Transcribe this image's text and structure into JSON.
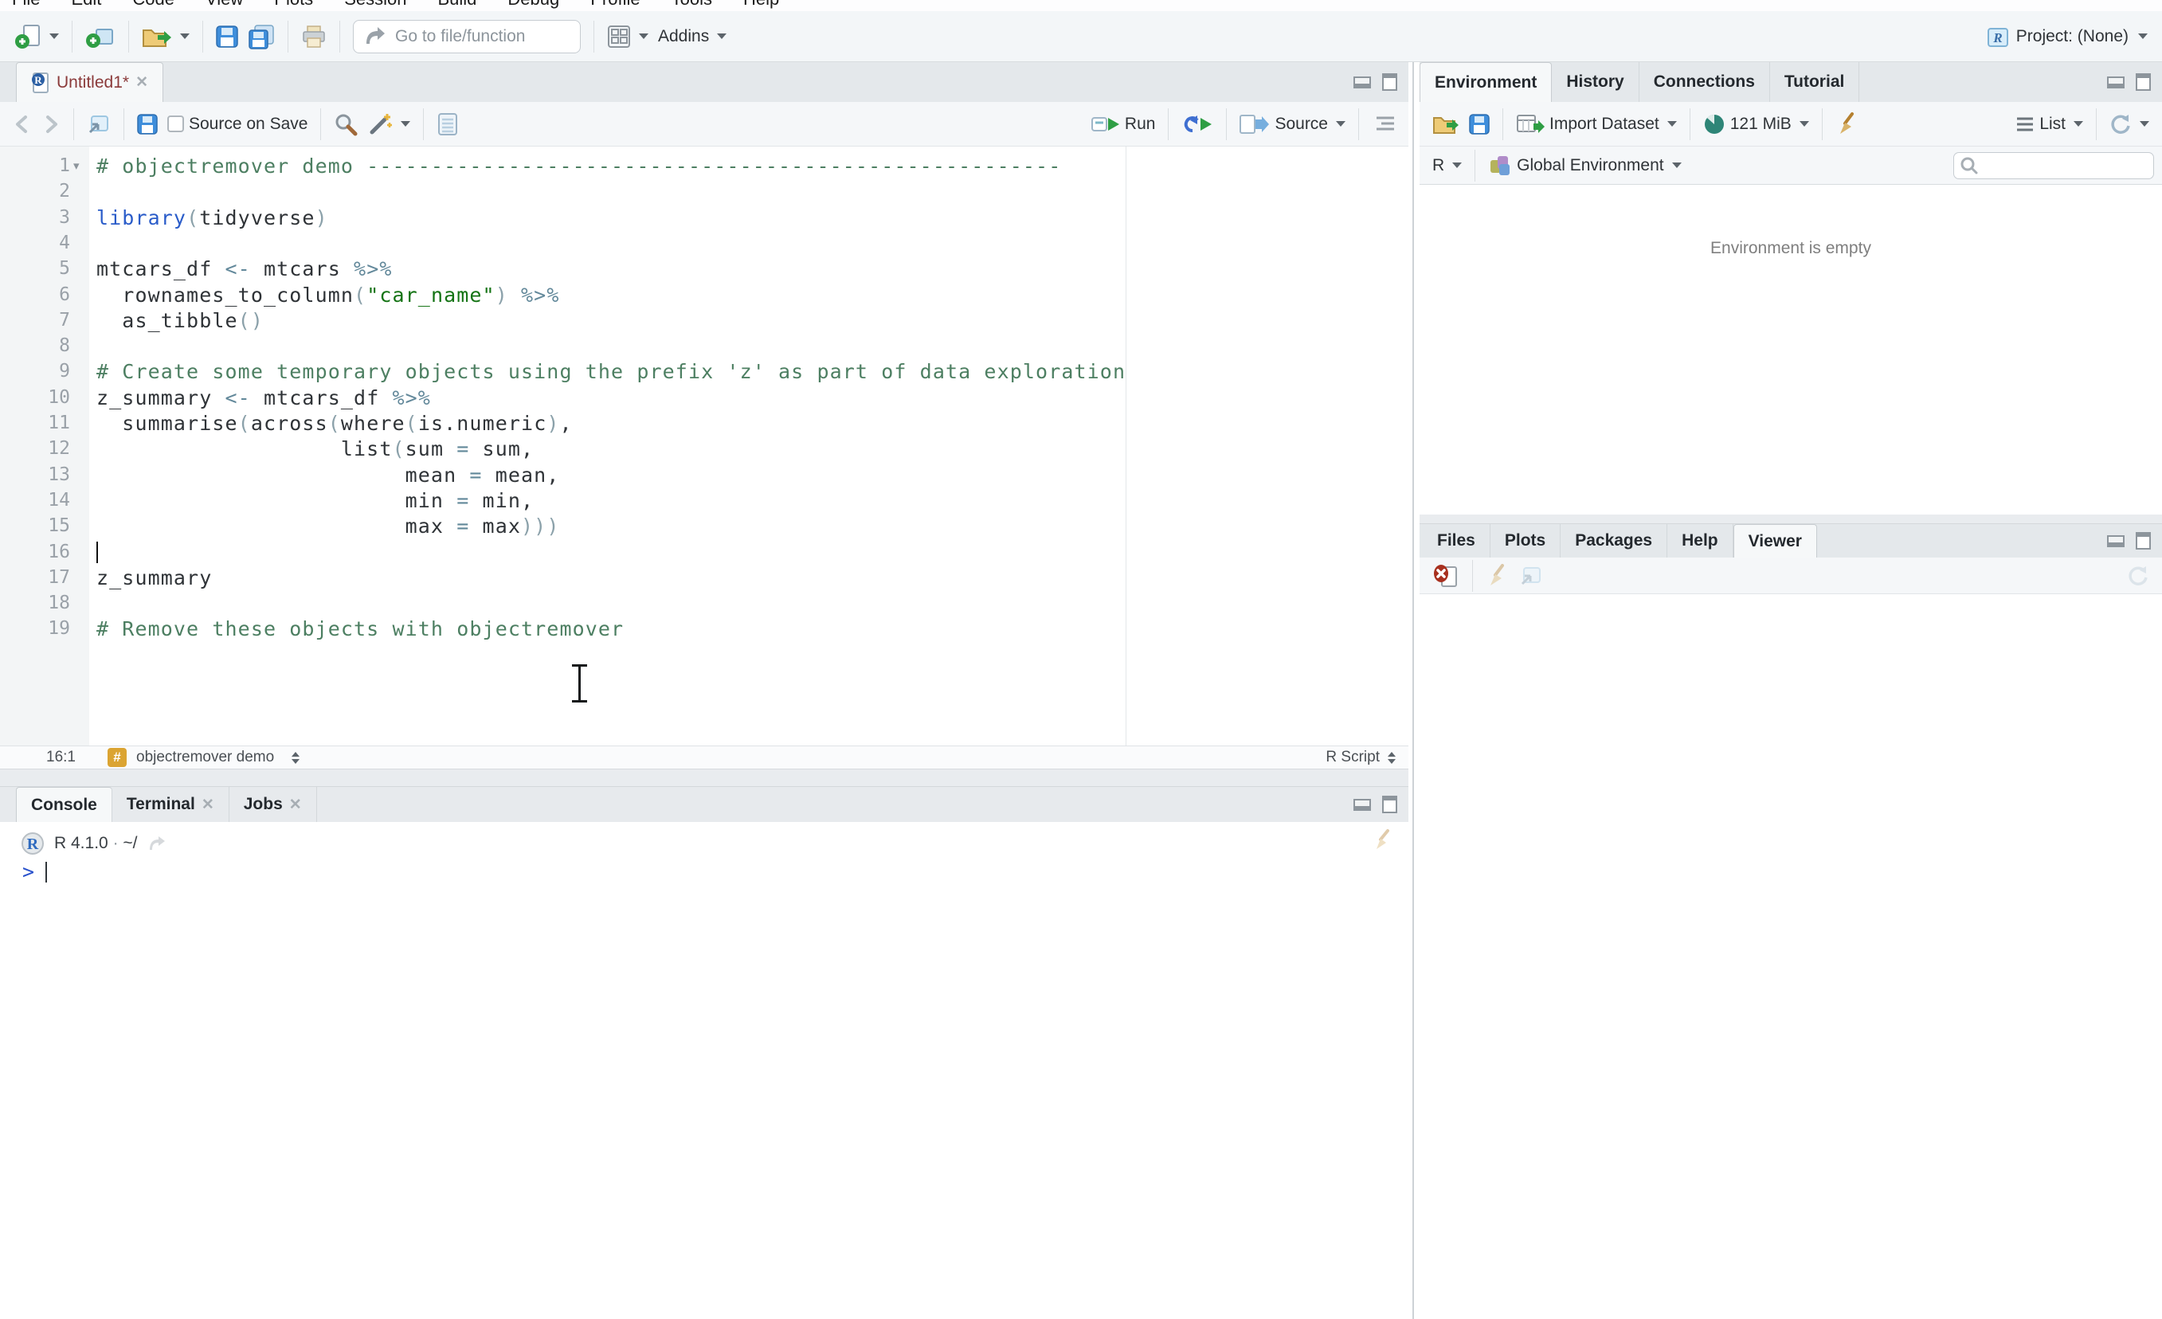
{
  "menu": [
    "File",
    "Edit",
    "Code",
    "View",
    "Plots",
    "Session",
    "Build",
    "Debug",
    "Profile",
    "Tools",
    "Help"
  ],
  "toolbar": {
    "goto_placeholder": "Go to file/function",
    "addins_label": "Addins",
    "project_label": "Project: (None)"
  },
  "source_pane": {
    "tab_title": "Untitled1*",
    "source_on_save_label": "Source on Save",
    "run_label": "Run",
    "source_label": "Source",
    "status": {
      "cursor_position": "16:1",
      "section_label": "objectremover demo",
      "file_type": "R Script"
    },
    "editor": {
      "cursor": {
        "line": 16,
        "column": 1
      },
      "lines": [
        {
          "n": 1,
          "fold": true,
          "tokens": [
            [
              "c",
              "# objectremover demo ------------------------------------------------------"
            ]
          ]
        },
        {
          "n": 2,
          "tokens": []
        },
        {
          "n": 3,
          "tokens": [
            [
              "k",
              "library"
            ],
            [
              "p",
              "("
            ],
            [
              "t",
              "tidyverse"
            ],
            [
              "p",
              ")"
            ]
          ]
        },
        {
          "n": 4,
          "tokens": []
        },
        {
          "n": 5,
          "tokens": [
            [
              "t",
              "mtcars_df "
            ],
            [
              "o",
              "<-"
            ],
            [
              "t",
              " mtcars "
            ],
            [
              "o",
              "%>%"
            ]
          ]
        },
        {
          "n": 6,
          "tokens": [
            [
              "t",
              "  rownames_to_column"
            ],
            [
              "p",
              "("
            ],
            [
              "s",
              "\"car_name\""
            ],
            [
              "p",
              ")"
            ],
            [
              "t",
              " "
            ],
            [
              "o",
              "%>%"
            ]
          ]
        },
        {
          "n": 7,
          "tokens": [
            [
              "t",
              "  as_tibble"
            ],
            [
              "p",
              "()"
            ]
          ]
        },
        {
          "n": 8,
          "tokens": []
        },
        {
          "n": 9,
          "tokens": [
            [
              "c",
              "# Create some temporary objects using the prefix 'z' as part of data exploration"
            ]
          ]
        },
        {
          "n": 10,
          "tokens": [
            [
              "t",
              "z_summary "
            ],
            [
              "o",
              "<-"
            ],
            [
              "t",
              " mtcars_df "
            ],
            [
              "o",
              "%>%"
            ]
          ]
        },
        {
          "n": 11,
          "tokens": [
            [
              "t",
              "  summarise"
            ],
            [
              "p",
              "("
            ],
            [
              "t",
              "across"
            ],
            [
              "p",
              "("
            ],
            [
              "t",
              "where"
            ],
            [
              "p",
              "("
            ],
            [
              "t",
              "is.numeric"
            ],
            [
              "p",
              ")"
            ],
            [
              "t",
              ","
            ]
          ]
        },
        {
          "n": 12,
          "tokens": [
            [
              "t",
              "                   list"
            ],
            [
              "p",
              "("
            ],
            [
              "t",
              "sum "
            ],
            [
              "o",
              "="
            ],
            [
              "t",
              " sum,"
            ]
          ]
        },
        {
          "n": 13,
          "tokens": [
            [
              "t",
              "                        mean "
            ],
            [
              "o",
              "="
            ],
            [
              "t",
              " mean,"
            ]
          ]
        },
        {
          "n": 14,
          "tokens": [
            [
              "t",
              "                        min "
            ],
            [
              "o",
              "="
            ],
            [
              "t",
              " min,"
            ]
          ]
        },
        {
          "n": 15,
          "tokens": [
            [
              "t",
              "                        max "
            ],
            [
              "o",
              "="
            ],
            [
              "t",
              " max"
            ],
            [
              "p",
              ")))"
            ]
          ]
        },
        {
          "n": 16,
          "tokens": []
        },
        {
          "n": 17,
          "tokens": [
            [
              "t",
              "z_summary"
            ]
          ]
        },
        {
          "n": 18,
          "tokens": []
        },
        {
          "n": 19,
          "tokens": [
            [
              "c",
              "# Remove these objects with objectremover"
            ]
          ]
        }
      ]
    }
  },
  "console_pane": {
    "tabs": [
      "Console",
      "Terminal",
      "Jobs"
    ],
    "r_version": "R 4.1.0",
    "separator": "·",
    "working_dir": "~/",
    "prompt": ">"
  },
  "environment_pane": {
    "tabs": [
      "Environment",
      "History",
      "Connections",
      "Tutorial"
    ],
    "r_dropdown_label": "R",
    "import_dataset_label": "Import Dataset",
    "memory_usage": "121 MiB",
    "list_label": "List",
    "environment_selector": "Global Environment",
    "empty_message": "Environment is empty"
  },
  "viewer_pane": {
    "tabs": [
      "Files",
      "Plots",
      "Packages",
      "Help",
      "Viewer"
    ]
  },
  "colors": {
    "comment": "#4d7f62",
    "keyword": "#2a5cc9",
    "string": "#147314",
    "operator": "#62889a",
    "prompt_blue": "#2a52cc",
    "modified_tab_title": "#8b3a3a",
    "section_badge": "#dba432",
    "run_green": "#2f9e44",
    "save_blue": "#3f8edb"
  }
}
